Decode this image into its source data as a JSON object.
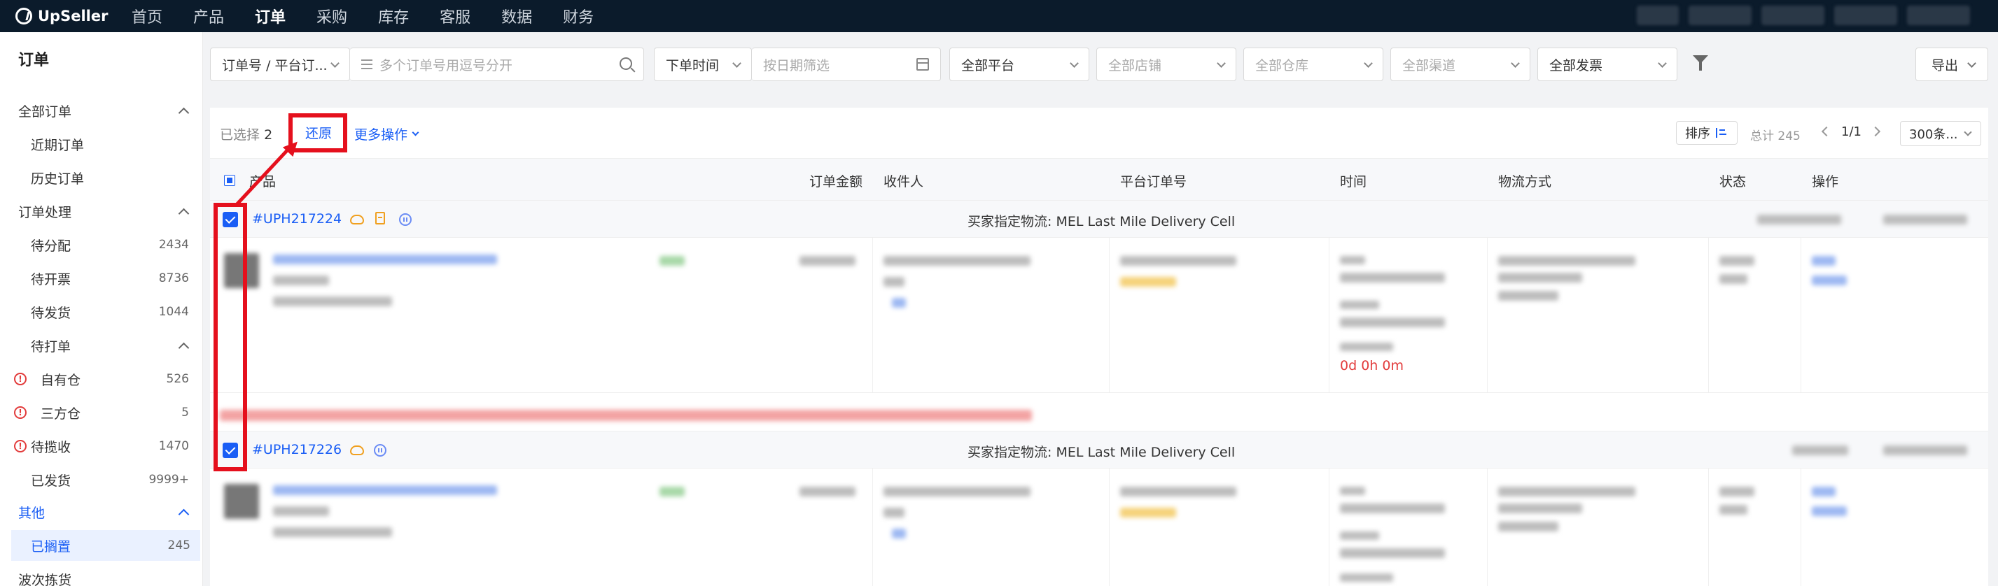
{
  "brand": {
    "name": "UpSeller",
    "accent": "#1a5ef5",
    "nav_bg": "#0b1b2b",
    "alert_red": "#e5101d"
  },
  "nav": {
    "items": [
      {
        "label": "首页"
      },
      {
        "label": "产品"
      },
      {
        "label": "订单"
      },
      {
        "label": "采购"
      },
      {
        "label": "库存"
      },
      {
        "label": "客服"
      },
      {
        "label": "数据"
      },
      {
        "label": "财务"
      }
    ],
    "active": "订单"
  },
  "sidebar": {
    "title": "订单",
    "all_orders": "全部订单",
    "recent_orders": "近期订单",
    "history_orders": "历史订单",
    "processing": "订单处理",
    "to_assign": {
      "label": "待分配",
      "count": "2434"
    },
    "to_invoice": {
      "label": "待开票",
      "count": "8736"
    },
    "to_ship": {
      "label": "待发货",
      "count": "1044"
    },
    "to_print": "待打单",
    "own_warehouse": {
      "label": "自有仓",
      "count": "526"
    },
    "third_warehouse": {
      "label": "三方仓",
      "count": "5"
    },
    "to_collect": {
      "label": "待揽收",
      "count": "1470"
    },
    "shipped": {
      "label": "已发货",
      "count": "9999+"
    },
    "other": "其他",
    "archived": {
      "label": "已搁置",
      "count": "245"
    },
    "wave_picking": "波次拣货"
  },
  "filters": {
    "search_type": "订单号 / 平台订...",
    "search_placeholder": "多个订单号用逗号分开",
    "time_type": "下单时间",
    "date_placeholder": "按日期筛选",
    "platform": "全部平台",
    "store": "全部店铺",
    "warehouse": "全部仓库",
    "channel": "全部渠道",
    "invoice": "全部发票",
    "export": "导出"
  },
  "actions": {
    "selected_label": "已选择",
    "selected_count": "2",
    "restore": "还原",
    "more": "更多操作",
    "sort": "排序",
    "total": "总计 245",
    "page": "1/1",
    "page_size": "300条..."
  },
  "table": {
    "headers": {
      "product": "产品",
      "amount": "订单金额",
      "recipient": "收件人",
      "platform_order": "平台订单号",
      "time": "时间",
      "shipping": "物流方式",
      "status": "状态",
      "ops": "操作"
    }
  },
  "orders": [
    {
      "no": "#UPH217224",
      "logistics": "买家指定物流: MEL Last Mile Delivery Cell",
      "countdown": "0d 0h 0m"
    },
    {
      "no": "#UPH217226",
      "logistics": "买家指定物流: MEL Last Mile Delivery Cell"
    }
  ]
}
